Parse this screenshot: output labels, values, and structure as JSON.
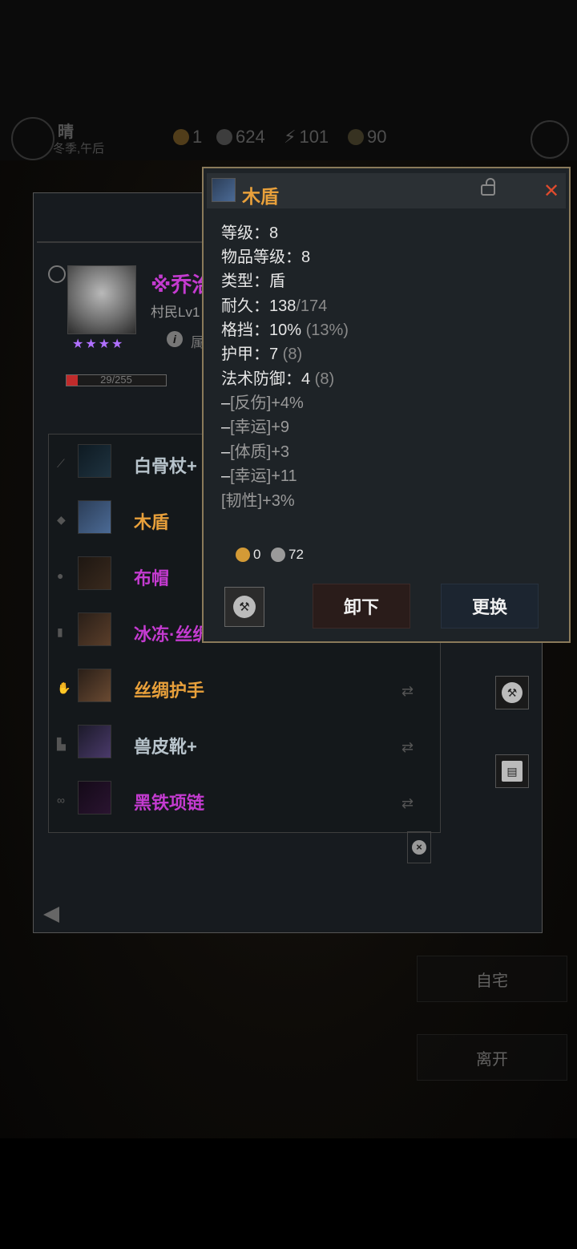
{
  "status_bar": {
    "weather": "晴",
    "season_time": "冬季,午后",
    "gold": "1",
    "silver": "624",
    "energy": "101",
    "food": "90"
  },
  "side_buttons": {
    "home": "自宅",
    "leave": "离开"
  },
  "character": {
    "name": "※乔治",
    "subtitle": "村民Lv1",
    "info_label": "属",
    "stars": "★★★★",
    "hp_text": "29/255",
    "hp_fraction": 0.114
  },
  "equipment": [
    {
      "slot_icon": "weapon-slot-icon",
      "name": "白骨杖+",
      "color": "#b8c4cc"
    },
    {
      "slot_icon": "shield-slot-icon",
      "name": "木盾",
      "color": "#e8a03b"
    },
    {
      "slot_icon": "helmet-slot-icon",
      "name": "布帽",
      "color": "#c43bd0"
    },
    {
      "slot_icon": "armor-slot-icon",
      "name": "冰冻·丝绸",
      "color": "#c43bd0"
    },
    {
      "slot_icon": "gloves-slot-icon",
      "name": "丝绸护手",
      "color": "#e8a03b"
    },
    {
      "slot_icon": "boots-slot-icon",
      "name": "兽皮靴+",
      "color": "#b8c4cc"
    },
    {
      "slot_icon": "necklace-slot-icon",
      "name": "黑铁项链",
      "color": "#c43bd0"
    }
  ],
  "tooltip": {
    "title": "木盾",
    "lines": [
      {
        "label": "等级：",
        "value": "8"
      },
      {
        "label": "物品等级：",
        "value": "8"
      },
      {
        "label": "类型：",
        "value": "盾"
      },
      {
        "label": "耐久：",
        "value": "138",
        "suffix": "/174"
      },
      {
        "label": "格挡：",
        "value": "10%",
        "suffix": " (13%)"
      },
      {
        "label": "护甲：",
        "value": "7",
        "suffix": " (8)"
      },
      {
        "label": "法术防御：",
        "value": "4",
        "suffix": " (8)"
      }
    ],
    "affixes": [
      {
        "dash": "–",
        "text": "[反伤]+4%"
      },
      {
        "dash": "–",
        "text": "[幸运]+9"
      },
      {
        "dash": "–",
        "text": "[体质]+3"
      },
      {
        "dash": "–",
        "text": "[幸运]+11"
      },
      {
        "dash": "",
        "text": "[韧性]+3%"
      }
    ],
    "gold_cost": "0",
    "silver_cost": "72",
    "unequip_label": "卸下",
    "replace_label": "更换"
  },
  "colors": {
    "gold_coin": "#d39a36",
    "silver_coin": "#9a9a9a",
    "quality_orange": "#e8a03b",
    "quality_purple": "#c43bd0",
    "close_red": "#e04b2d"
  }
}
